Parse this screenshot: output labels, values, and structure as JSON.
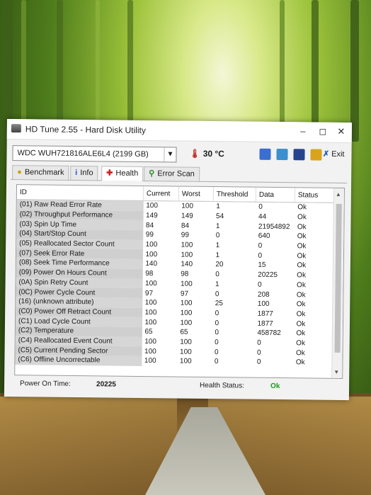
{
  "window": {
    "title": "HD Tune 2.55 - Hard Disk Utility"
  },
  "toolbar": {
    "drive": "WDC    WUH721816ALE6L4 (2199 GB)",
    "temperature": "30 °C",
    "exit_label": "Exit"
  },
  "tabs": [
    {
      "label": "Benchmark",
      "icon": "lightbulb-icon"
    },
    {
      "label": "Info",
      "icon": "info-icon"
    },
    {
      "label": "Health",
      "icon": "red-cross-icon",
      "active": true
    },
    {
      "label": "Error Scan",
      "icon": "magnifier-icon"
    }
  ],
  "table": {
    "headers": [
      "ID",
      "Current",
      "Worst",
      "Threshold",
      "Data",
      "Status"
    ],
    "rows": [
      [
        "(01) Raw Read Error Rate",
        "100",
        "100",
        "1",
        "0",
        "Ok"
      ],
      [
        "(02) Throughput Performance",
        "149",
        "149",
        "54",
        "44",
        "Ok"
      ],
      [
        "(03) Spin Up Time",
        "84",
        "84",
        "1",
        "21954892",
        "Ok"
      ],
      [
        "(04) Start/Stop Count",
        "99",
        "99",
        "0",
        "640",
        "Ok"
      ],
      [
        "(05) Reallocated Sector Count",
        "100",
        "100",
        "1",
        "0",
        "Ok"
      ],
      [
        "(07) Seek Error Rate",
        "100",
        "100",
        "1",
        "0",
        "Ok"
      ],
      [
        "(08) Seek Time Performance",
        "140",
        "140",
        "20",
        "15",
        "Ok"
      ],
      [
        "(09) Power On Hours Count",
        "98",
        "98",
        "0",
        "20225",
        "Ok"
      ],
      [
        "(0A) Spin Retry Count",
        "100",
        "100",
        "1",
        "0",
        "Ok"
      ],
      [
        "(0C) Power Cycle Count",
        "97",
        "97",
        "0",
        "208",
        "Ok"
      ],
      [
        "(16) (unknown attribute)",
        "100",
        "100",
        "25",
        "100",
        "Ok"
      ],
      [
        "(C0) Power Off Retract Count",
        "100",
        "100",
        "0",
        "1877",
        "Ok"
      ],
      [
        "(C1) Load Cycle Count",
        "100",
        "100",
        "0",
        "1877",
        "Ok"
      ],
      [
        "(C2) Temperature",
        "65",
        "65",
        "0",
        "458782",
        "Ok"
      ],
      [
        "(C4) Reallocated Event Count",
        "100",
        "100",
        "0",
        "0",
        "Ok"
      ],
      [
        "(C5) Current Pending Sector",
        "100",
        "100",
        "0",
        "0",
        "Ok"
      ],
      [
        "(C6) Offline Uncorrectable",
        "100",
        "100",
        "0",
        "0",
        "Ok"
      ]
    ]
  },
  "status": {
    "power_on_label": "Power On Time:",
    "power_on_value": "20225",
    "health_label": "Health Status:",
    "health_value": "Ok"
  },
  "colors": {
    "ok_green": "#1a9a1a",
    "exit_blue": "#1c57c9",
    "temp_red": "#c21b1b"
  }
}
